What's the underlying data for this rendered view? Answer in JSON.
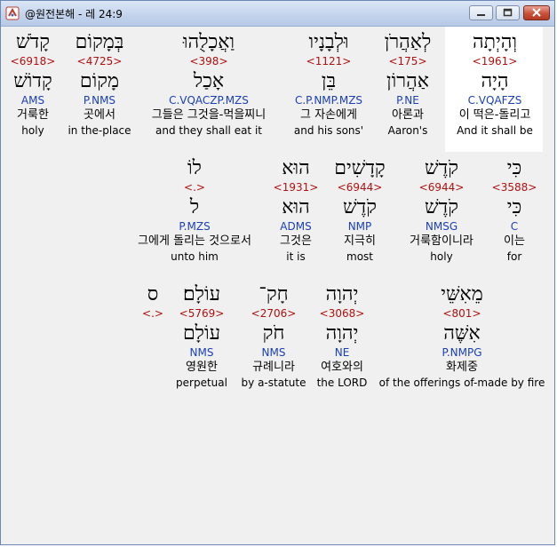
{
  "window": {
    "title": "@원전본해 - 레 24:9"
  },
  "rows": [
    [
      {
        "he": "וְהָיְתָה",
        "num": "<1961>",
        "lex": "הָיָה",
        "morph": "C.VQAFZS",
        "ko": "이 떡은-돌리고",
        "en": "And it shall be"
      },
      {
        "he": "לְאַהֲרֹן",
        "num": "<175>",
        "lex": "אַהֲרוֹן",
        "morph": "P.NE",
        "ko": "아론과",
        "en": "Aaron's"
      },
      {
        "he": "וּלְבָנָיו",
        "num": "<1121>",
        "lex": "בֵּן",
        "morph": "C.P.NMP.MZS",
        "ko": "그 자손에게",
        "en": "and his sons'"
      },
      {
        "he": "וַאֲכָלֻהוּ",
        "num": "<398>",
        "lex": "אָכַל",
        "morph": "C.VQACZP.MZS",
        "ko": "그들은 그것을-먹을찌니",
        "en": "and they shall eat it"
      },
      {
        "he": "בְּמָקוֹם",
        "num": "<4725>",
        "lex": "מָקוֹם",
        "morph": "P.NMS",
        "ko": "곳에서",
        "en": "in the-place"
      },
      {
        "he": "קָדֹשׁ",
        "num": "<6918>",
        "lex": "קָדוֹשׁ",
        "morph": "AMS",
        "ko": "거룩한",
        "en": "holy"
      }
    ],
    [
      {
        "he": "כִּי",
        "num": "<3588>",
        "lex": "כִּי",
        "morph": "C",
        "ko": "이는",
        "en": "for"
      },
      {
        "he": "קֹדֶשׁ",
        "num": "<6944>",
        "lex": "קֹדֶשׁ",
        "morph": "NMSG",
        "ko": "거룩함이니라",
        "en": "holy"
      },
      {
        "he": "קָדָשִׁים",
        "num": "<6944>",
        "lex": "קֹדֶשׁ",
        "morph": "NMP",
        "ko": "지극히",
        "en": "most"
      },
      {
        "he": "הוּא",
        "num": "<1931>",
        "lex": "הוּא",
        "morph": "ADMS",
        "ko": "그것은",
        "en": "it is"
      },
      {
        "he": "לוֹ",
        "num": "<.>",
        "lex": "ל",
        "morph": "P.MZS",
        "ko": "그에게 돌리는 것으로서",
        "en": "unto him"
      }
    ],
    [
      {
        "he": "מֵאִשֵּׁי",
        "num": "<801>",
        "lex": "אִשֶּׁה",
        "morph": "P.NMPG",
        "ko": "화제중",
        "en": "of the offerings of-made by fire"
      },
      {
        "he": "יְהוָה",
        "num": "<3068>",
        "lex": "יְהוָה",
        "morph": "NE",
        "ko": "여호와의",
        "en": "the LORD"
      },
      {
        "he": "חָק־",
        "num": "<2706>",
        "lex": "חֹק",
        "morph": "NMS",
        "ko": "규례니라",
        "en": "by a-statute"
      },
      {
        "he": "עוֹלָם׃",
        "num": "<5769>",
        "lex": "עוֹלָם",
        "morph": "NMS",
        "ko": "영원한",
        "en": "perpetual"
      },
      {
        "he": "ס",
        "num": "<.>",
        "lex": "",
        "morph": "",
        "ko": "",
        "en": ""
      }
    ]
  ]
}
